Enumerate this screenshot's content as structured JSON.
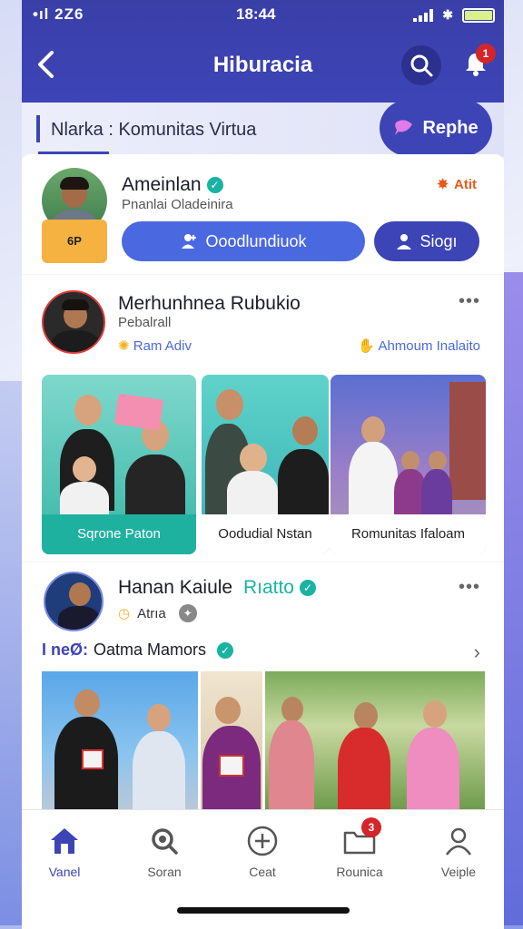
{
  "status_bar": {
    "left": "•ıl 2Z6",
    "time": "18:44"
  },
  "header": {
    "title": "Hiburacia"
  },
  "notifications": {
    "count": "1"
  },
  "community": {
    "title": "Nlarka : Komunitas Virtua",
    "reply_label": "Rephe"
  },
  "profile": {
    "name": "Ameinlan",
    "subtitle": "Pnanlai Oladeinira",
    "avatar_tag": "6P",
    "status": "Atit",
    "follow_label": "Ooodlundiuok",
    "share_label": "Siogı"
  },
  "post1": {
    "author": "Merhunhnea Rubukio",
    "subtitle": "Pebalrall",
    "tag_left": "Ram Adiv",
    "tag_right": "Ahmoum Inalaito",
    "photos": [
      {
        "caption": "Sqrone Paton"
      },
      {
        "caption": "Oodudial Nstan"
      },
      {
        "caption": "Romunitas Ifaloam"
      }
    ]
  },
  "post2": {
    "author": "Hanan Kaiule",
    "author_tag": "Rıatto",
    "meta": "Atrıa",
    "album_prefix": "I neØ:",
    "album_title": "Oatma Mamors"
  },
  "nav": [
    {
      "label": "Vanel",
      "icon": "home-icon",
      "active": true
    },
    {
      "label": "Soran",
      "icon": "search-icon"
    },
    {
      "label": "Ceat",
      "icon": "plus-circle-icon"
    },
    {
      "label": "Rounica",
      "icon": "folder-icon",
      "badge": "3"
    },
    {
      "label": "Veiple",
      "icon": "person-icon"
    }
  ],
  "colors": {
    "primary": "#3d44b6",
    "accent_teal": "#19b3a3",
    "badge_red": "#d3252a",
    "status_orange": "#e85a1b"
  }
}
